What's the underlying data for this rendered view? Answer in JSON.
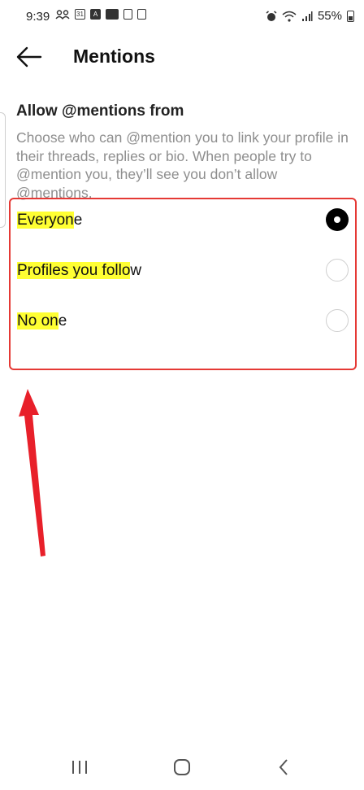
{
  "status_bar": {
    "time": "9:39",
    "battery": "55%",
    "icons_left": [
      "people-icon",
      "calendar-31-icon",
      "a-icon",
      "news-icon",
      "phone-icon",
      "phone-icon"
    ],
    "calendar_day": "31",
    "icons_right": [
      "alarm-icon",
      "wifi-icon",
      "signal-icon",
      "battery-icon"
    ]
  },
  "header": {
    "title": "Mentions",
    "back_icon": "arrow-left-icon"
  },
  "section": {
    "title": "Allow @mentions from",
    "description": "Choose who can @mention you to link your profile in their threads, replies or bio. When people try to @mention you, they’ll see you don’t allow @mentions."
  },
  "options": [
    {
      "label_highlighted": "Everyon",
      "label_rest": "e",
      "selected": true
    },
    {
      "label_highlighted": "Profiles you follo",
      "label_rest": "w",
      "selected": false
    },
    {
      "label_highlighted": "No on",
      "label_rest": "e",
      "selected": false
    }
  ],
  "annotation": {
    "box_color": "#e53935",
    "highlight_color": "#ffff33",
    "arrow_color": "#e8202a"
  },
  "nav_bar": {
    "buttons": [
      "recents-icon",
      "home-icon",
      "back-icon"
    ]
  }
}
